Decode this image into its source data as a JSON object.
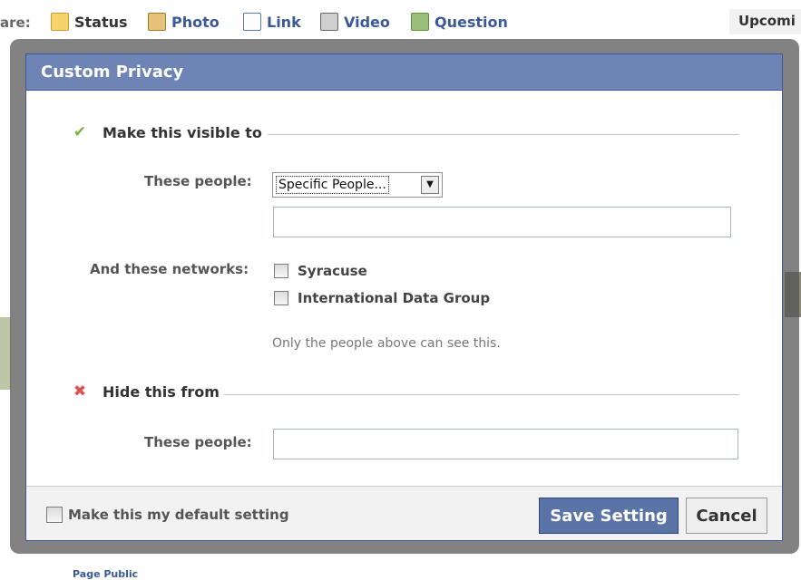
{
  "background": {
    "share_label": "are:",
    "share_items": [
      {
        "label": "Status",
        "icon": "status-icon",
        "color": "#f3c23d"
      },
      {
        "label": "Photo",
        "icon": "photo-icon",
        "color": "#d7a24c"
      },
      {
        "label": "Link",
        "icon": "link-icon",
        "color": "#5a7cb6"
      },
      {
        "label": "Video",
        "icon": "video-icon",
        "color": "#666666"
      },
      {
        "label": "Question",
        "icon": "question-icon",
        "color": "#5d8e3a"
      }
    ],
    "upcoming_label": "Upcomi",
    "footer_text": "Page Public"
  },
  "dialog": {
    "title": "Custom Privacy",
    "visible_section": {
      "icon": "checkmark-icon",
      "title": "Make this visible to",
      "people_label": "These people:",
      "people_select_value": "Specific People...",
      "people_input_value": "",
      "networks_label": "And these networks:",
      "networks": [
        {
          "label": "Syracuse",
          "checked": false
        },
        {
          "label": "International Data Group",
          "checked": false
        }
      ],
      "note": "Only the people above can see this."
    },
    "hide_section": {
      "icon": "cross-icon",
      "title": "Hide this from",
      "people_label": "These people:",
      "people_input_value": ""
    },
    "footer": {
      "default_checkbox_label": "Make this my default setting",
      "default_checked": false,
      "save_label": "Save Setting",
      "cancel_label": "Cancel"
    }
  },
  "colors": {
    "header_blue": "#6d84b4",
    "link_blue": "#3b5998",
    "save_button": "#5b74a8",
    "check_green": "#7cb342",
    "cross_red": "#d9534f"
  }
}
